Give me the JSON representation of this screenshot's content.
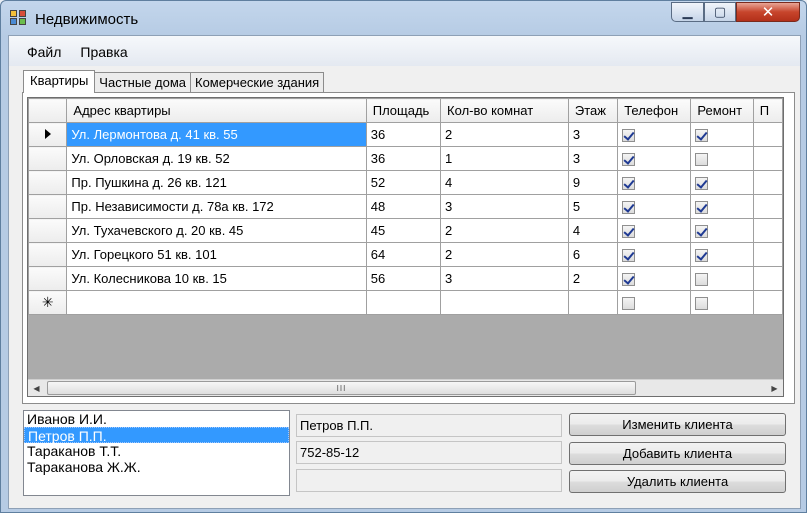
{
  "window": {
    "title": "Недвижимость",
    "min_glyph": "▁",
    "max_glyph": "▢",
    "close_glyph": "✕"
  },
  "menu": [
    {
      "label": "Файл"
    },
    {
      "label": "Правка"
    }
  ],
  "tabs": [
    {
      "label": "Квартиры",
      "active": true
    },
    {
      "label": "Частные дома",
      "active": false
    },
    {
      "label": "Комерческие здания",
      "active": false
    }
  ],
  "grid": {
    "columns": [
      "Адрес квартиры",
      "Площадь",
      "Кол-во комнат",
      "Этаж",
      "Телефон",
      "Ремонт",
      "П"
    ],
    "rows": [
      {
        "address": "Ул. Лермонтова д. 41 кв. 55",
        "area": "36",
        "rooms": "2",
        "floor": "3",
        "phone": true,
        "repair": true
      },
      {
        "address": "Ул. Орловская д. 19 кв. 52",
        "area": "36",
        "rooms": "1",
        "floor": "3",
        "phone": true,
        "repair": false
      },
      {
        "address": "Пр. Пушкина д. 26 кв. 121",
        "area": "52",
        "rooms": "4",
        "floor": "9",
        "phone": true,
        "repair": true
      },
      {
        "address": "Пр. Независимости д. 78а кв. 172",
        "area": "48",
        "rooms": "3",
        "floor": "5",
        "phone": true,
        "repair": true
      },
      {
        "address": "Ул. Тухачевского д. 20 кв. 45",
        "area": "45",
        "rooms": "2",
        "floor": "4",
        "phone": true,
        "repair": true
      },
      {
        "address": "Ул. Горецкого 51 кв. 101",
        "area": "64",
        "rooms": "2",
        "floor": "6",
        "phone": true,
        "repair": true
      },
      {
        "address": "Ул. Колесникова 10 кв. 15",
        "area": "56",
        "rooms": "3",
        "floor": "2",
        "phone": true,
        "repair": false
      }
    ],
    "new_row_glyph": "✳",
    "selected_row_glyph": "▶",
    "scroll_left_glyph": "◀",
    "scroll_right_glyph": "▶",
    "scroll_thumb_glyph": "III"
  },
  "clients": {
    "items": [
      "Иванов И.И.",
      "Петров П.П.",
      "Тараканов Т.Т.",
      "Тараканова Ж.Ж."
    ],
    "selected_index": 1
  },
  "details": {
    "name": "Петров П.П.",
    "phone": "752-85-12",
    "extra": ""
  },
  "buttons": {
    "edit": "Изменить клиента",
    "add": "Добавить клиента",
    "delete": "Удалить клиента"
  },
  "colors": {
    "selection": "#3399ff",
    "accent_close": "#c7452c"
  }
}
